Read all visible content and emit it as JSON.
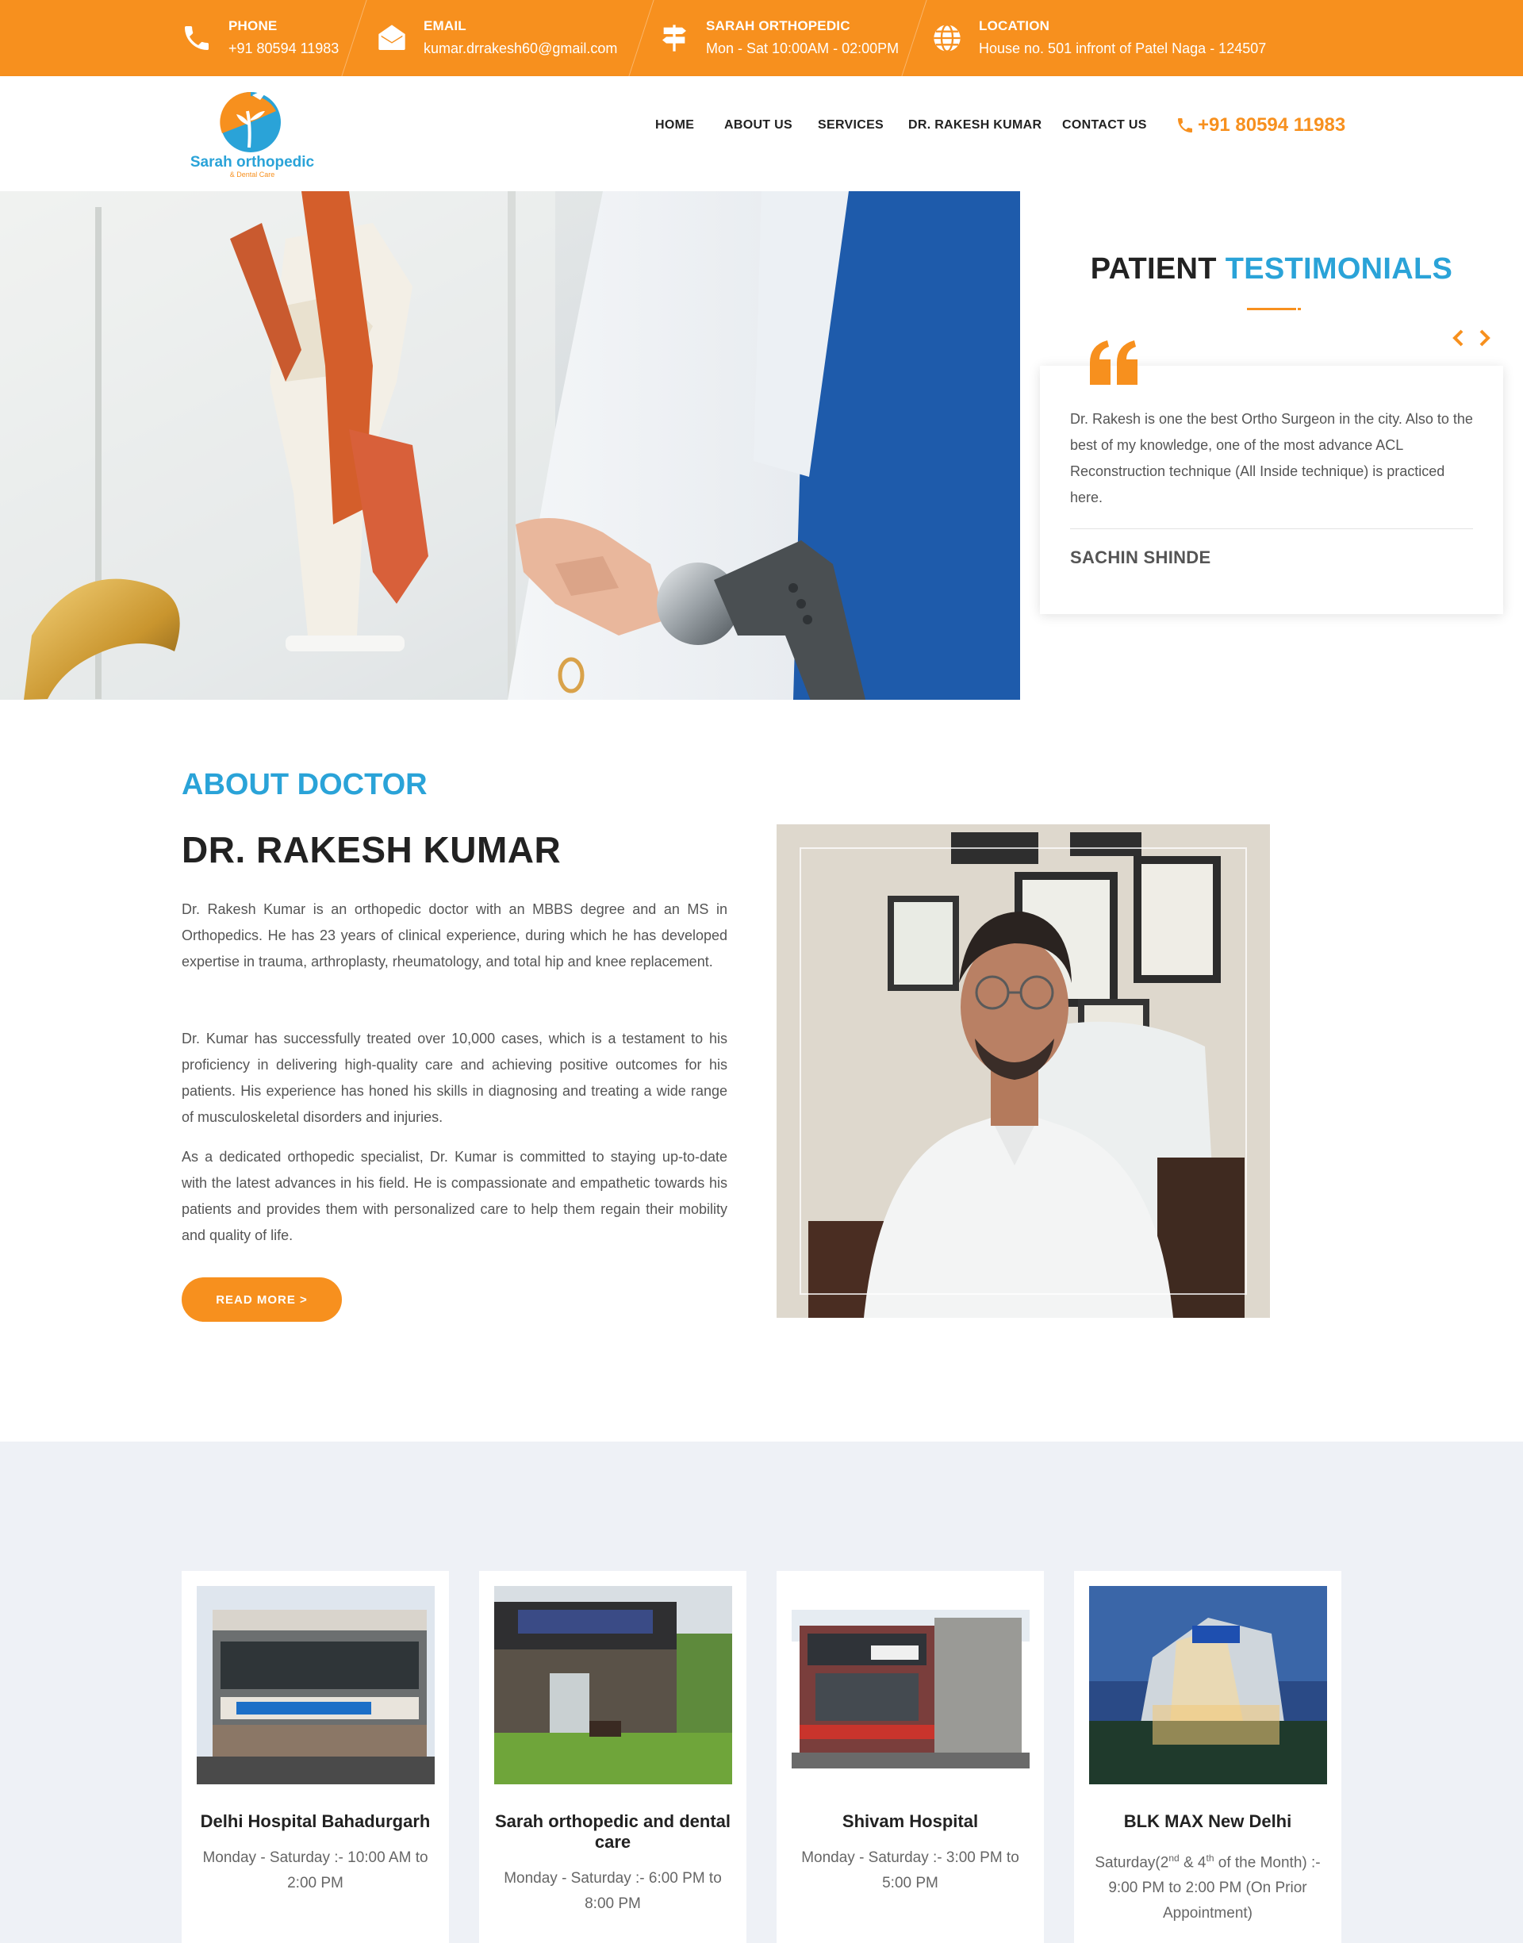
{
  "topbar": {
    "phone_label": "PHONE",
    "phone_value": "+91 80594 11983",
    "email_label": "EMAIL",
    "email_value": "kumar.drrakesh60@gmail.com",
    "clinic_label": "SARAH ORTHOPEDIC",
    "clinic_value": "Mon - Sat 10:00AM - 02:00PM",
    "location_label": "LOCATION",
    "location_value": "House no. 501 infront of Patel Naga - 124507"
  },
  "brand": {
    "name": "Sarah orthopedic",
    "sub": "& Dental Care",
    "accent": "#f7901e",
    "blue": "#2aa3d8"
  },
  "nav": {
    "items": [
      "HOME",
      "ABOUT US",
      "SERVICES",
      "DR. RAKESH KUMAR",
      "CONTACT US"
    ],
    "phone": "+91 80594 11983"
  },
  "testimonials": {
    "title_a": "PATIENT",
    "title_b": "TESTIMONIALS",
    "text": "Dr. Rakesh is one the best Ortho Surgeon in the city. Also to the best of my knowledge, one of the most advance ACL Reconstruction technique (All Inside technique) is practiced here.",
    "name": "SACHIN SHINDE"
  },
  "about": {
    "kicker": "ABOUT DOCTOR",
    "name": "DR. RAKESH KUMAR",
    "p1": "Dr. Rakesh Kumar is an orthopedic doctor with an MBBS degree and an MS in Orthopedics. He has 23 years of clinical experience, during which he has developed expertise in trauma, arthroplasty, rheumatology, and total hip and knee replacement.",
    "p2": "Dr. Kumar has successfully treated over 10,000 cases, which is a testament to his proficiency in delivering high-quality care and achieving positive outcomes for his patients. His experience has honed his skills in diagnosing and treating a wide range of musculoskeletal disorders and injuries.",
    "p3": "As a dedicated orthopedic specialist, Dr. Kumar is committed to staying up-to-date with the latest advances in his field. He is compassionate and empathetic towards his patients and provides them with personalized care to help them regain their mobility and quality of life.",
    "button": "READ MORE >"
  },
  "hospitals": [
    {
      "name": "Delhi Hospital Bahadurgarh",
      "time": "Monday - Saturday :- 10:00 AM to 2:00 PM"
    },
    {
      "name": "Sarah orthopedic and dental care",
      "time": "Monday - Saturday :- 6:00 PM to 8:00 PM"
    },
    {
      "name": "Shivam Hospital",
      "time": "Monday - Saturday :- 3:00 PM to 5:00 PM"
    },
    {
      "name": "BLK MAX New Delhi",
      "time_pre": "Saturday(2",
      "sup1": "nd",
      "time_mid": " & 4",
      "sup2": "th",
      "time_post": " of the Month) :- 9:00 PM to 2:00 PM (On Prior Appointment)"
    }
  ],
  "icons": [
    "phone-icon",
    "envelope-icon",
    "signpost-icon",
    "globe-icon",
    "quote-icon",
    "chevron-left-icon",
    "chevron-right-icon"
  ]
}
